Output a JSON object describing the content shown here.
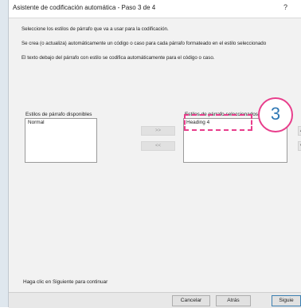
{
  "dialog": {
    "title": "Asistente de codificación automática - Paso 3 de 4",
    "help": "?"
  },
  "instructions": [
    "Seleccione los estilos de párrafo que va a usar para la codificación.",
    "Se crea (o actualiza) automáticamente un código o caso para cada párrafo formateado en el estilo seleccionado",
    "El texto debajo del párrafo con estilo se codifica automáticamente para el código o caso."
  ],
  "available": {
    "label": "Estilos de párrafo disponibles",
    "items": [
      "Normal"
    ]
  },
  "selected": {
    "label": "Estilos de párrafo seleccionados",
    "items": [
      "Heading 4"
    ]
  },
  "transfer": {
    "add_label": ">>",
    "remove_label": "<<"
  },
  "order": {
    "up_label": "▲",
    "down_label": "▼"
  },
  "footer_hint": "Haga clic en Siguiente para continuar",
  "buttons": {
    "cancel": "Cancelar",
    "back": "Atrás",
    "next": "Siguie"
  },
  "callout": {
    "number": "3",
    "color": "#e83e8c"
  }
}
